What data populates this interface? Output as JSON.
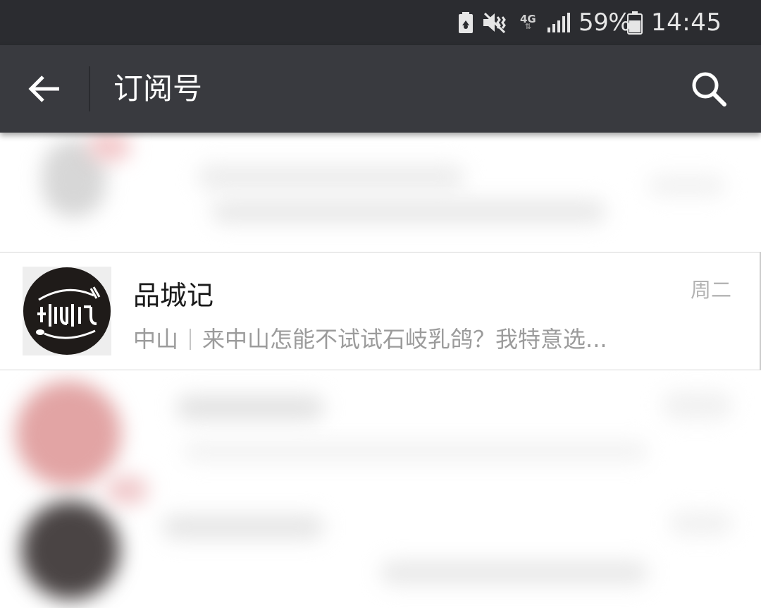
{
  "status_bar": {
    "network": "4G",
    "battery_percent": "59%",
    "time": "14:45",
    "icons": [
      "battery-saver-icon",
      "vibrate-mute-icon",
      "network-4g-icon",
      "signal-icon",
      "battery-icon"
    ]
  },
  "toolbar": {
    "title": "订阅号",
    "back_icon": "arrow-left-icon",
    "search_icon": "search-icon"
  },
  "rows": [
    {
      "title": "品城记",
      "time": "周二",
      "source": "中山",
      "preview": "来中山怎能不试试石岐乳鸽？我特意选...",
      "avatar_icon": "pinchengji-logo"
    }
  ],
  "colors": {
    "status_bar_bg": "#2b2c30",
    "toolbar_bg": "#393a3f",
    "list_bg": "#ffffff",
    "title_text": "#1a1a1a",
    "secondary_text": "#9b9b9b"
  }
}
